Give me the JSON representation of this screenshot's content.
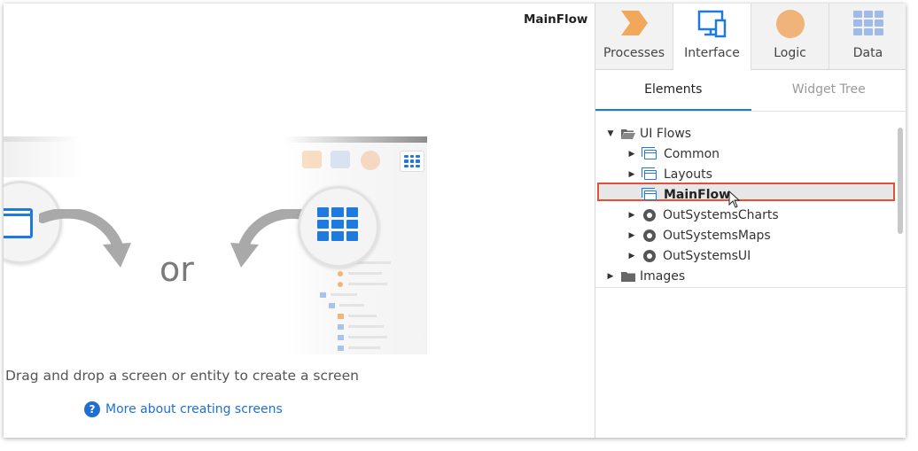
{
  "canvas": {
    "flow_title": "MainFlow",
    "or_text": "or",
    "drag_text": "Drag and drop a screen or entity to create a screen",
    "help_link": "More about creating screens"
  },
  "panel": {
    "tabs": [
      {
        "label": "Processes",
        "icon": "processes-icon",
        "active": false
      },
      {
        "label": "Interface",
        "icon": "interface-icon",
        "active": true
      },
      {
        "label": "Logic",
        "icon": "logic-icon",
        "active": false
      },
      {
        "label": "Data",
        "icon": "data-icon",
        "active": false
      }
    ],
    "subtabs": [
      {
        "label": "Elements",
        "active": true
      },
      {
        "label": "Widget Tree",
        "active": false
      }
    ],
    "tree": [
      {
        "label": "UI Flows",
        "icon": "folder-open-icon",
        "expanded": true
      },
      {
        "label": "Common",
        "icon": "ui-flow-icon",
        "expanded": false
      },
      {
        "label": "Layouts",
        "icon": "ui-flow-icon",
        "expanded": false
      },
      {
        "label": "MainFlow",
        "icon": "ui-flow-icon",
        "selected": true
      },
      {
        "label": "OutSystemsCharts",
        "icon": "module-icon",
        "expanded": false
      },
      {
        "label": "OutSystemsMaps",
        "icon": "module-icon",
        "expanded": false
      },
      {
        "label": "OutSystemsUI",
        "icon": "module-icon",
        "expanded": false
      },
      {
        "label": "Images",
        "icon": "folder-icon",
        "expanded": false
      }
    ]
  },
  "colors": {
    "accent": "#1f7ae0",
    "selection_outline": "#e0503a",
    "processes": "#f2a85b",
    "logic": "#f0b47a",
    "data": "#9fbbe6"
  }
}
